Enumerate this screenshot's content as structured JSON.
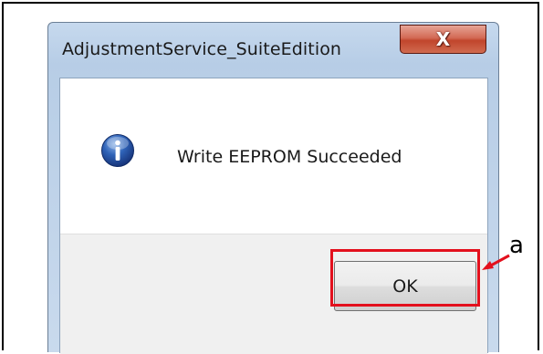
{
  "dialog": {
    "title": "AdjustmentService_SuiteEdition",
    "close_symbol": "X",
    "message": "Write EEPROM Succeeded",
    "icon": "info-icon",
    "ok_label": "OK"
  },
  "annotation": {
    "label": "a",
    "color": "#e3101d"
  },
  "colors": {
    "title_bar": "#c6d9ee",
    "close_button": "#c1452c",
    "footer": "#f0f0f0"
  }
}
